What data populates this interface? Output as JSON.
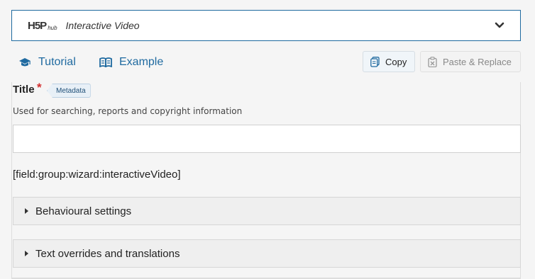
{
  "hub": {
    "logo_main": "H5P",
    "logo_sub": "hub",
    "title": "Interactive Video"
  },
  "links": {
    "tutorial": "Tutorial",
    "example": "Example"
  },
  "buttons": {
    "copy": "Copy",
    "paste": "Paste & Replace"
  },
  "form": {
    "title_label": "Title",
    "required_mark": "*",
    "metadata_label": "Metadata",
    "title_description": "Used for searching, reports and copyright information",
    "title_value": "",
    "field_group_text": "[field:group:wizard:interactiveVideo]"
  },
  "sections": [
    {
      "label": "Behavioural settings"
    },
    {
      "label": "Text overrides and translations"
    }
  ],
  "colors": {
    "accent": "#1f6aa0",
    "required": "#d32f2f"
  }
}
